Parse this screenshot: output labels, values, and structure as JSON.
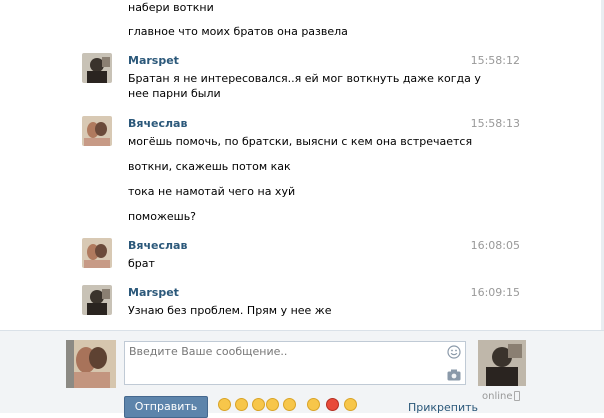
{
  "messages_partial": [
    "набери воткни",
    "главное что моих братов она развела"
  ],
  "groups": [
    {
      "author": "Marspet",
      "time": "15:58:12",
      "lines": [
        "Братан я не интересовался..я ей мог воткнуть даже когда у нее парни были"
      ]
    },
    {
      "author": "Вячеслав",
      "time": "15:58:13",
      "lines": [
        "могёшь помочь, по братски, выясни с кем она встречается",
        "воткни, скажешь потом как",
        "тока не намотай чего на хуй",
        "поможешь?"
      ]
    },
    {
      "author": "Вячеслав",
      "time": "16:08:05",
      "lines": [
        "брат"
      ]
    },
    {
      "author": "Marspet",
      "time": "16:09:15",
      "lines": [
        "Узнаю без проблем. Прям у нее же"
      ]
    }
  ],
  "composer": {
    "placeholder": "Введите Ваше сообщение..",
    "send_label": "Отправить",
    "attach_label": "Прикрепить",
    "status": "online"
  },
  "icons": {
    "smile": "smile-icon",
    "camera": "camera-icon",
    "phone": "mobile-phone-icon"
  },
  "colors": {
    "author": "#2b587a",
    "send_button": "#5d84ab",
    "time": "#999999",
    "composer_bg": "#f2f4f6"
  }
}
